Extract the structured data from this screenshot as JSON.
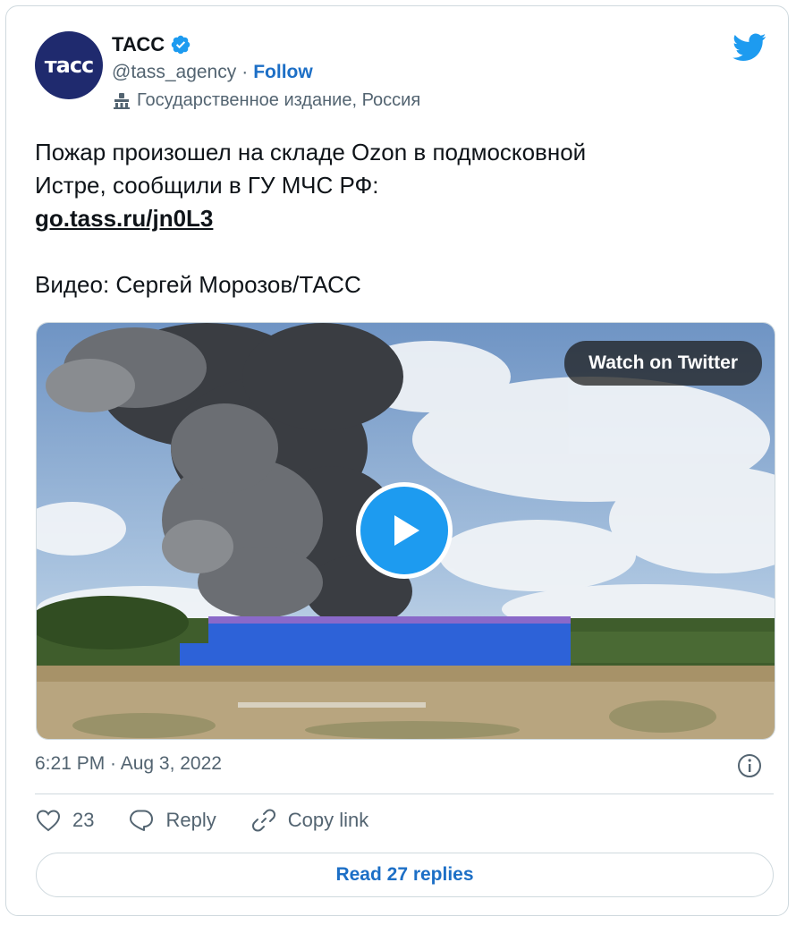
{
  "author": {
    "avatar_text": "тасс",
    "name": "ТАСС",
    "handle": "@tass_agency",
    "separator": "·",
    "follow_label": "Follow",
    "label": "Государственное издание, Россия"
  },
  "tweet": {
    "line1": "Пожар произошел на складе Ozon в подмосковной",
    "line2": "Истре, сообщили в ГУ МЧС РФ:",
    "link": "go.tass.ru/jn0L3",
    "credit": "Видео: Сергей Морозов/ТАСС"
  },
  "media": {
    "watch_label": "Watch on Twitter"
  },
  "meta": {
    "timestamp": "6:21 PM · Aug 3, 2022"
  },
  "actions": {
    "likes": "23",
    "reply_label": "Reply",
    "copy_label": "Copy link"
  },
  "read_replies_label": "Read 27 replies",
  "colors": {
    "accent": "#1d9bf0",
    "link": "#1d6fc6",
    "secondary_text": "#536471",
    "border": "#cfd9de",
    "avatar_bg": "#1f2a6e"
  },
  "icons": [
    "verified-badge-icon",
    "twitter-bird-icon",
    "government-building-icon",
    "play-icon",
    "info-icon",
    "heart-icon",
    "reply-bubble-icon",
    "link-icon"
  ]
}
